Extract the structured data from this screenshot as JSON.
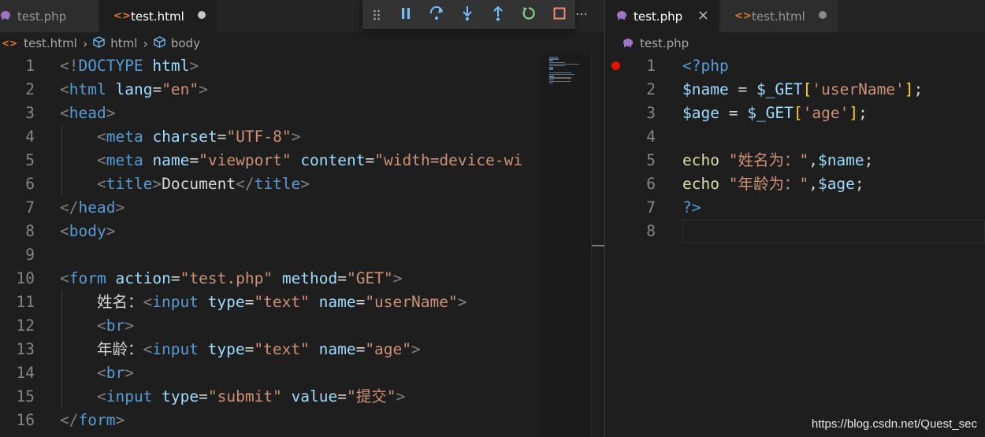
{
  "left_editor": {
    "tabs": [
      {
        "label": "test.php",
        "icon": "php-elephant-icon",
        "active": false
      },
      {
        "label": "test.html",
        "icon": "html-brackets-icon",
        "active": true,
        "dirty": true
      }
    ],
    "breadcrumb": [
      "test.html",
      "html",
      "body"
    ],
    "line_numbers": [
      "1",
      "2",
      "3",
      "4",
      "5",
      "6",
      "7",
      "8",
      "9",
      "10",
      "11",
      "12",
      "13",
      "14",
      "15",
      "16"
    ],
    "lines": [
      [
        [
          "punc",
          "<!"
        ],
        [
          "tag",
          "DOCTYPE"
        ],
        [
          "text",
          " "
        ],
        [
          "attr",
          "html"
        ],
        [
          "punc",
          ">"
        ]
      ],
      [
        [
          "punc",
          "<"
        ],
        [
          "tag",
          "html"
        ],
        [
          "text",
          " "
        ],
        [
          "attr",
          "lang"
        ],
        [
          "text",
          "="
        ],
        [
          "str",
          "\"en\""
        ],
        [
          "punc",
          ">"
        ]
      ],
      [
        [
          "punc",
          "<"
        ],
        [
          "tag",
          "head"
        ],
        [
          "punc",
          ">"
        ]
      ],
      [
        [
          "text",
          "    "
        ],
        [
          "punc",
          "<"
        ],
        [
          "tag",
          "meta"
        ],
        [
          "text",
          " "
        ],
        [
          "attr",
          "charset"
        ],
        [
          "text",
          "="
        ],
        [
          "str",
          "\"UTF-8\""
        ],
        [
          "punc",
          ">"
        ]
      ],
      [
        [
          "text",
          "    "
        ],
        [
          "punc",
          "<"
        ],
        [
          "tag",
          "meta"
        ],
        [
          "text",
          " "
        ],
        [
          "attr",
          "name"
        ],
        [
          "text",
          "="
        ],
        [
          "str",
          "\"viewport\""
        ],
        [
          "text",
          " "
        ],
        [
          "attr",
          "content"
        ],
        [
          "text",
          "="
        ],
        [
          "str",
          "\"width=device-wi"
        ]
      ],
      [
        [
          "text",
          "    "
        ],
        [
          "punc",
          "<"
        ],
        [
          "tag",
          "title"
        ],
        [
          "punc",
          ">"
        ],
        [
          "text",
          "Document"
        ],
        [
          "punc",
          "</"
        ],
        [
          "tag",
          "title"
        ],
        [
          "punc",
          ">"
        ]
      ],
      [
        [
          "punc",
          "</"
        ],
        [
          "tag",
          "head"
        ],
        [
          "punc",
          ">"
        ]
      ],
      [
        [
          "punc",
          "<"
        ],
        [
          "tag",
          "body"
        ],
        [
          "punc",
          ">"
        ]
      ],
      [],
      [
        [
          "punc",
          "<"
        ],
        [
          "tag",
          "form"
        ],
        [
          "text",
          " "
        ],
        [
          "attr",
          "action"
        ],
        [
          "text",
          "="
        ],
        [
          "str",
          "\"test.php\""
        ],
        [
          "text",
          " "
        ],
        [
          "attr",
          "method"
        ],
        [
          "text",
          "="
        ],
        [
          "str",
          "\"GET\""
        ],
        [
          "punc",
          ">"
        ]
      ],
      [
        [
          "text",
          "    姓名："
        ],
        [
          "punc",
          "<"
        ],
        [
          "tag",
          "input"
        ],
        [
          "text",
          " "
        ],
        [
          "attr",
          "type"
        ],
        [
          "text",
          "="
        ],
        [
          "str",
          "\"text\""
        ],
        [
          "text",
          " "
        ],
        [
          "attr",
          "name"
        ],
        [
          "text",
          "="
        ],
        [
          "str",
          "\"userName\""
        ],
        [
          "punc",
          ">"
        ]
      ],
      [
        [
          "text",
          "    "
        ],
        [
          "punc",
          "<"
        ],
        [
          "tag",
          "br"
        ],
        [
          "punc",
          ">"
        ]
      ],
      [
        [
          "text",
          "    年龄："
        ],
        [
          "punc",
          "<"
        ],
        [
          "tag",
          "input"
        ],
        [
          "text",
          " "
        ],
        [
          "attr",
          "type"
        ],
        [
          "text",
          "="
        ],
        [
          "str",
          "\"text\""
        ],
        [
          "text",
          " "
        ],
        [
          "attr",
          "name"
        ],
        [
          "text",
          "="
        ],
        [
          "str",
          "\"age\""
        ],
        [
          "punc",
          ">"
        ]
      ],
      [
        [
          "text",
          "    "
        ],
        [
          "punc",
          "<"
        ],
        [
          "tag",
          "br"
        ],
        [
          "punc",
          ">"
        ]
      ],
      [
        [
          "text",
          "    "
        ],
        [
          "punc",
          "<"
        ],
        [
          "tag",
          "input"
        ],
        [
          "text",
          " "
        ],
        [
          "attr",
          "type"
        ],
        [
          "text",
          "="
        ],
        [
          "str",
          "\"submit\""
        ],
        [
          "text",
          " "
        ],
        [
          "attr",
          "value"
        ],
        [
          "text",
          "="
        ],
        [
          "str",
          "\"提交\""
        ],
        [
          "punc",
          ">"
        ]
      ],
      [
        [
          "punc",
          "</"
        ],
        [
          "tag",
          "form"
        ],
        [
          "punc",
          ">"
        ]
      ]
    ]
  },
  "right_editor": {
    "tabs": [
      {
        "label": "test.php",
        "icon": "php-elephant-icon",
        "active": true,
        "close": "×"
      },
      {
        "label": "test.html",
        "icon": "html-brackets-icon",
        "active": false,
        "dirty": true
      }
    ],
    "breadcrumb": [
      "test.php"
    ],
    "line_numbers": [
      "1",
      "2",
      "3",
      "4",
      "5",
      "6",
      "7",
      "8"
    ],
    "lines": [
      [
        [
          "php",
          "<?php"
        ]
      ],
      [
        [
          "var",
          "$name"
        ],
        [
          "text",
          " = "
        ],
        [
          "var",
          "$_GET"
        ],
        [
          "brk",
          "["
        ],
        [
          "str",
          "'userName'"
        ],
        [
          "brk",
          "]"
        ],
        [
          "text",
          ";"
        ]
      ],
      [
        [
          "var",
          "$age"
        ],
        [
          "text",
          " = "
        ],
        [
          "var",
          "$_GET"
        ],
        [
          "brk",
          "["
        ],
        [
          "str",
          "'age'"
        ],
        [
          "brk",
          "]"
        ],
        [
          "text",
          ";"
        ]
      ],
      [],
      [
        [
          "fn",
          "echo"
        ],
        [
          "text",
          " "
        ],
        [
          "str",
          "\"姓名为：\""
        ],
        [
          "text",
          ","
        ],
        [
          "var",
          "$name"
        ],
        [
          "text",
          ";"
        ]
      ],
      [
        [
          "fn",
          "echo"
        ],
        [
          "text",
          " "
        ],
        [
          "str",
          "\"年龄为：\""
        ],
        [
          "text",
          ","
        ],
        [
          "var",
          "$age"
        ],
        [
          "text",
          ";"
        ]
      ],
      [
        [
          "php",
          "?>"
        ]
      ],
      []
    ]
  },
  "debug_toolbar": {
    "buttons": [
      "pause-icon",
      "step-over-icon",
      "step-into-icon",
      "step-out-icon",
      "restart-icon",
      "stop-icon"
    ],
    "colors": {
      "pause": "#75beff",
      "step": "#75beff",
      "restart": "#89d185",
      "stop": "#f48771"
    }
  },
  "watermark": "https://blog.csdn.net/Quest_sec"
}
